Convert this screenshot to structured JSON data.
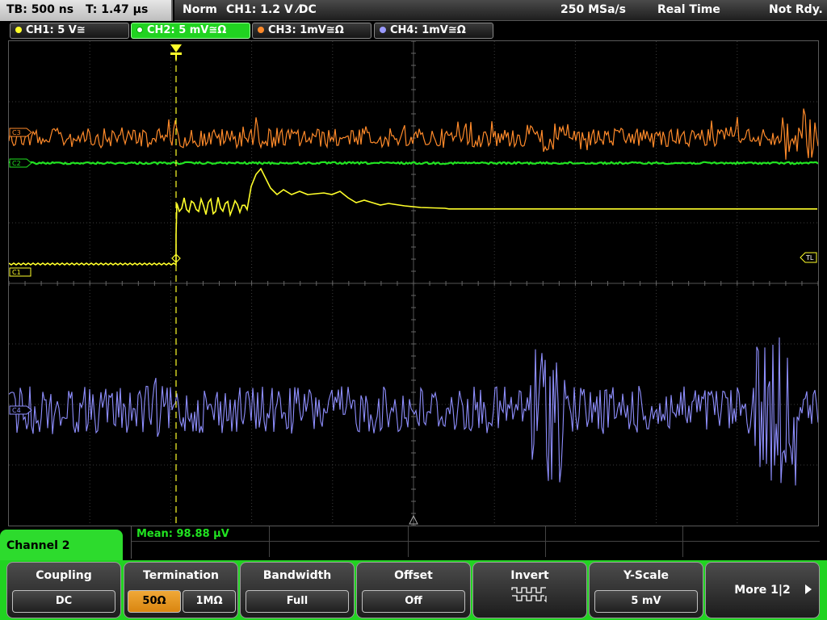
{
  "topbar": {
    "timebase": "TB: 500 ns",
    "trigger_time": "T: 1.47 µs",
    "mode": "Norm",
    "trigger": "CH1: 1.2 V ⁄DC",
    "sample_rate": "250 MSa/s",
    "acquisition": "Real Time",
    "state": "Not Rdy."
  },
  "channels": [
    {
      "label": "CH1: 5 V≅",
      "color": "#ffff2a"
    },
    {
      "label": "CH2: 5 mV≅Ω",
      "color": "#21e321",
      "active": true
    },
    {
      "label": "CH3: 1mV≅Ω",
      "color": "#ff8a2a"
    },
    {
      "label": "CH4: 1mV≅Ω",
      "color": "#9a9aff"
    }
  ],
  "markers": {
    "ch3": "C3",
    "ch2": "C2",
    "ch1": "C1",
    "ch4": "C4",
    "trigger_level": "TL"
  },
  "measurement": {
    "mean": "Mean: 98.88 µV"
  },
  "channel_menu": {
    "title": "Channel 2"
  },
  "softkeys": {
    "coupling": {
      "caption": "Coupling",
      "value": "DC"
    },
    "termination": {
      "caption": "Termination",
      "opt1": "50Ω",
      "opt2": "1MΩ"
    },
    "bandwidth": {
      "caption": "Bandwidth",
      "value": "Full"
    },
    "offset": {
      "caption": "Offset",
      "value": "Off"
    },
    "invert": {
      "caption": "Invert"
    },
    "yscale": {
      "caption": "Y-Scale",
      "value": "5 mV"
    },
    "more": {
      "label": "More 1|2"
    }
  }
}
